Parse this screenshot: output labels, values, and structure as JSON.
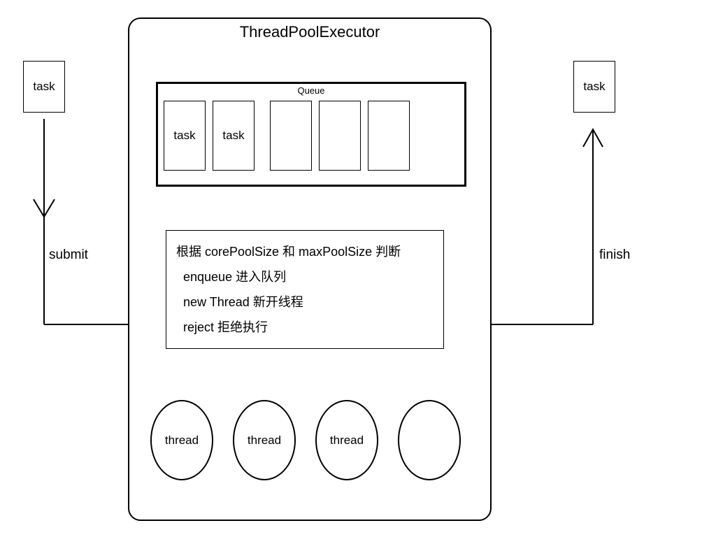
{
  "leftTask": {
    "label": "task"
  },
  "rightTask": {
    "label": "task"
  },
  "submitLabel": "submit",
  "finishLabel": "finish",
  "main": {
    "title": "ThreadPoolExecutor",
    "queue": {
      "title": "Queue",
      "slots": [
        "task",
        "task",
        "",
        "",
        ""
      ]
    },
    "decision": {
      "heading": "根据 corePoolSize 和 maxPoolSize 判断",
      "lines": [
        "enqueue 进入队列",
        "new Thread 新开线程",
        "reject 拒绝执行"
      ]
    },
    "threads": [
      "thread",
      "thread",
      "thread",
      ""
    ]
  }
}
